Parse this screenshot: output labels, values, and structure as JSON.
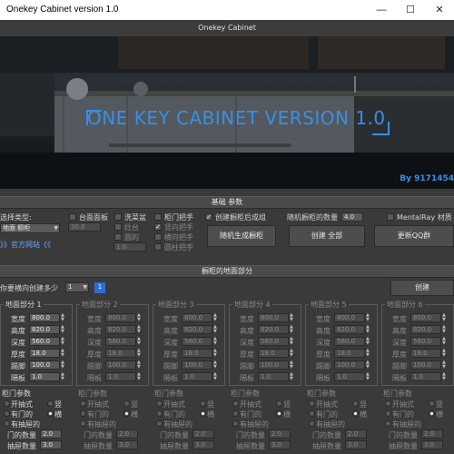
{
  "window": {
    "title": "Onekey Cabinet version 1.0",
    "controls": {
      "minimize": "—",
      "maximize": "☐",
      "close": "✕"
    }
  },
  "panel": {
    "title": "Onekey Cabinet"
  },
  "hero": {
    "title": "ONE KEY CABINET VERSION 1.0",
    "byline": "By 9171454"
  },
  "basic": {
    "header": "基础 参数",
    "type_label": "选择类型:",
    "type_value": "地面 橱柜",
    "website_link": "》》官方网站《《",
    "countertop": {
      "label": "台面面板",
      "value": "30.0"
    },
    "wash_basin": {
      "label": "洗菜盆"
    },
    "stove": {
      "label": "灶台"
    },
    "round": {
      "label": "圆的"
    },
    "round_value": "1.0",
    "handle": {
      "label": "柜门把手"
    },
    "vertical_handle": {
      "label": "竖向把手"
    },
    "horizontal_handle": {
      "label": "横向把手"
    },
    "round_handle": {
      "label": "圆柱把手"
    },
    "create_after": {
      "label": "创建橱柜后成组"
    },
    "random_button": "随机生成橱柜",
    "count_label": "随机橱柜的数量",
    "count_value": "4.0",
    "create_all_button": "创建 全部",
    "mentalray_label": "MentalRay 材质",
    "update_qq_button": "更新QQ群"
  },
  "floor": {
    "header": "橱柜的地面部分",
    "count_label": "你要横向创建多少",
    "count_value": "1",
    "badge": "1",
    "create_button": "创建",
    "parts": [
      {
        "title": "地面部分 1",
        "fields": [
          {
            "label": "宽度",
            "value": "800.0"
          },
          {
            "label": "高度",
            "value": "820.0"
          },
          {
            "label": "深度",
            "value": "560.0"
          },
          {
            "label": "厚度",
            "value": "18.0"
          },
          {
            "label": "踢脚",
            "value": "100.0"
          },
          {
            "label": "隔板",
            "value": "1.0"
          }
        ]
      },
      {
        "title": "地面部分 2",
        "fields": [
          {
            "label": "宽度",
            "value": "800.0"
          },
          {
            "label": "高度",
            "value": "820.0"
          },
          {
            "label": "深度",
            "value": "560.0"
          },
          {
            "label": "厚度",
            "value": "18.0"
          },
          {
            "label": "踢脚",
            "value": "100.0"
          },
          {
            "label": "隔板",
            "value": "1.0"
          }
        ]
      },
      {
        "title": "地面部分 3",
        "fields": [
          {
            "label": "宽度",
            "value": "800.0"
          },
          {
            "label": "高度",
            "value": "820.0"
          },
          {
            "label": "深度",
            "value": "560.0"
          },
          {
            "label": "厚度",
            "value": "18.0"
          },
          {
            "label": "踢脚",
            "value": "100.0"
          },
          {
            "label": "隔板",
            "value": "1.0"
          }
        ]
      },
      {
        "title": "地面部分 4",
        "fields": [
          {
            "label": "宽度",
            "value": "800.0"
          },
          {
            "label": "高度",
            "value": "820.0"
          },
          {
            "label": "深度",
            "value": "560.0"
          },
          {
            "label": "厚度",
            "value": "18.0"
          },
          {
            "label": "踢脚",
            "value": "100.0"
          },
          {
            "label": "隔板",
            "value": "1.0"
          }
        ]
      },
      {
        "title": "地面部分 5",
        "fields": [
          {
            "label": "宽度",
            "value": "800.0"
          },
          {
            "label": "高度",
            "value": "820.0"
          },
          {
            "label": "深度",
            "value": "560.0"
          },
          {
            "label": "厚度",
            "value": "18.0"
          },
          {
            "label": "踢脚",
            "value": "100.0"
          },
          {
            "label": "隔板",
            "value": "1.0"
          }
        ]
      },
      {
        "title": "地面部分 6",
        "fields": [
          {
            "label": "宽度",
            "value": "800.0"
          },
          {
            "label": "高度",
            "value": "820.0"
          },
          {
            "label": "深度",
            "value": "560.0"
          },
          {
            "label": "厚度",
            "value": "18.0"
          },
          {
            "label": "踢脚",
            "value": "100.0"
          },
          {
            "label": "隔板",
            "value": "1.0"
          }
        ]
      }
    ],
    "door_section": {
      "title": "柜门参数",
      "opt_open": "开抽式",
      "opt_vertical": "竖",
      "opt_with_door": "有门的",
      "opt_horizontal": "横",
      "opt_drawer": "有抽屉的",
      "door_count_label": "门的数量",
      "door_count_value": "2.0",
      "drawer_count_label": "抽屉数量",
      "drawer_count_value": "3.0"
    }
  },
  "colors": {
    "accent": "#3a8ee6",
    "link": "#6aa6ff",
    "badge": "#2b6fd6"
  }
}
